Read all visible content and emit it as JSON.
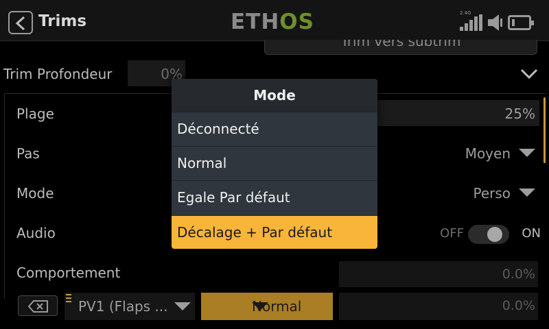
{
  "header": {
    "title": "Trims",
    "logo_part1": "ETH",
    "logo_part2": "OS",
    "signal_label": "2.4G"
  },
  "top_button": {
    "label": "Trim vers subtrim"
  },
  "trim_section": {
    "label": "Trim Profondeur",
    "value": "0%"
  },
  "settings": {
    "plage": {
      "label": "Plage",
      "value": "25%"
    },
    "pas": {
      "label": "Pas",
      "value": "Moyen"
    },
    "mode": {
      "label": "Mode",
      "value": "Perso"
    },
    "audio": {
      "label": "Audio",
      "off_label": "OFF",
      "on_label": "ON",
      "state": "on"
    },
    "comportement": {
      "label": "Comportement",
      "value": "0.0%"
    },
    "bottom": {
      "source": "PV1 (Flaps ...",
      "mode": "Normal",
      "value": "0.0%"
    }
  },
  "popup": {
    "title": "Mode",
    "options": [
      {
        "label": "Déconnecté"
      },
      {
        "label": "Normal"
      },
      {
        "label": "Egale Par défaut"
      },
      {
        "label": "Décalage + Par défaut"
      }
    ],
    "selected_index": 3
  },
  "colors": {
    "accent": "#f8b53a",
    "accent_dark": "#a97e24",
    "popup_bg": "#2f363d",
    "logo_green": "#6e8f2a"
  }
}
